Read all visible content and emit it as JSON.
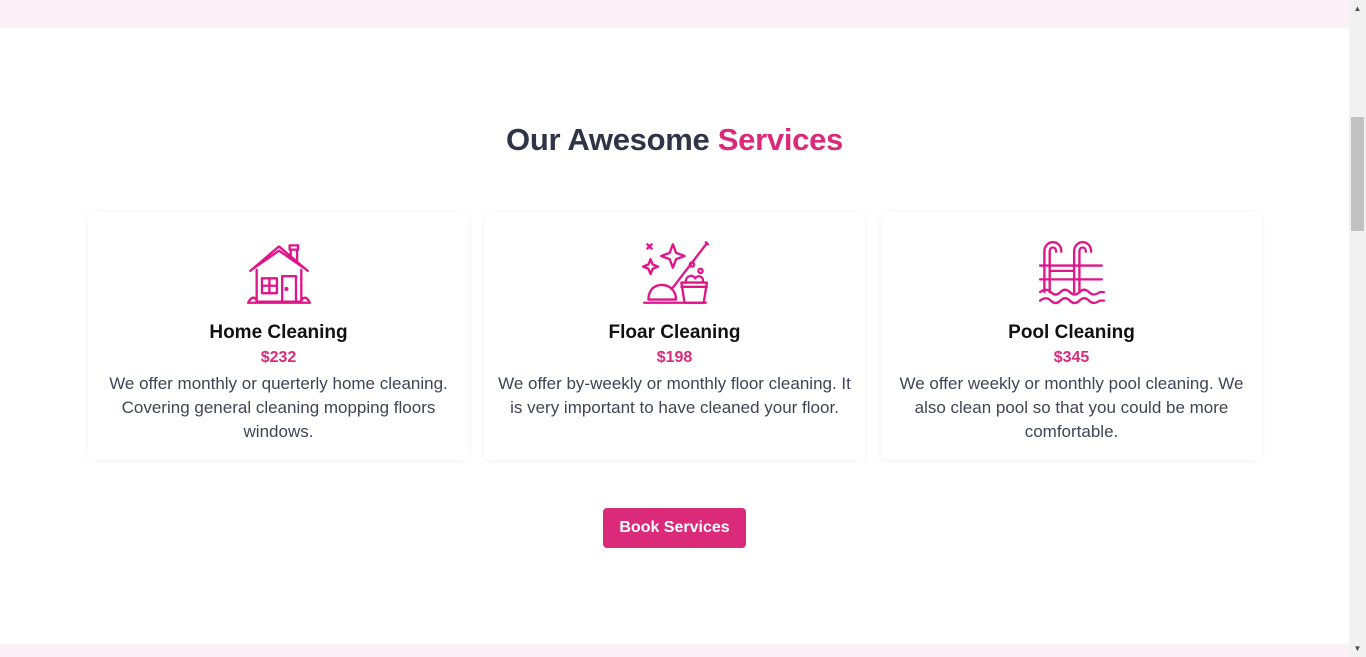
{
  "section": {
    "title_main": "Our Awesome",
    "title_accent": "Services"
  },
  "services": [
    {
      "name": "Home Cleaning",
      "price": "$232",
      "description": "We offer monthly or querterly home cleaning. Covering general cleaning mopping floors windows.",
      "icon": "house-icon"
    },
    {
      "name": "Floar Cleaning",
      "price": "$198",
      "description": "We offer by-weekly or monthly floor cleaning. It is very important to have cleaned your floor.",
      "icon": "mop-bucket-icon"
    },
    {
      "name": "Pool Cleaning",
      "price": "$345",
      "description": "We offer weekly or monthly pool cleaning. We also clean pool so that you could be more comfortable.",
      "icon": "pool-ladder-icon"
    }
  ],
  "cta": {
    "label": "Book Services"
  },
  "colors": {
    "accent": "#dc2a7b",
    "heading": "#2f3447",
    "band": "#fcf1f6"
  }
}
